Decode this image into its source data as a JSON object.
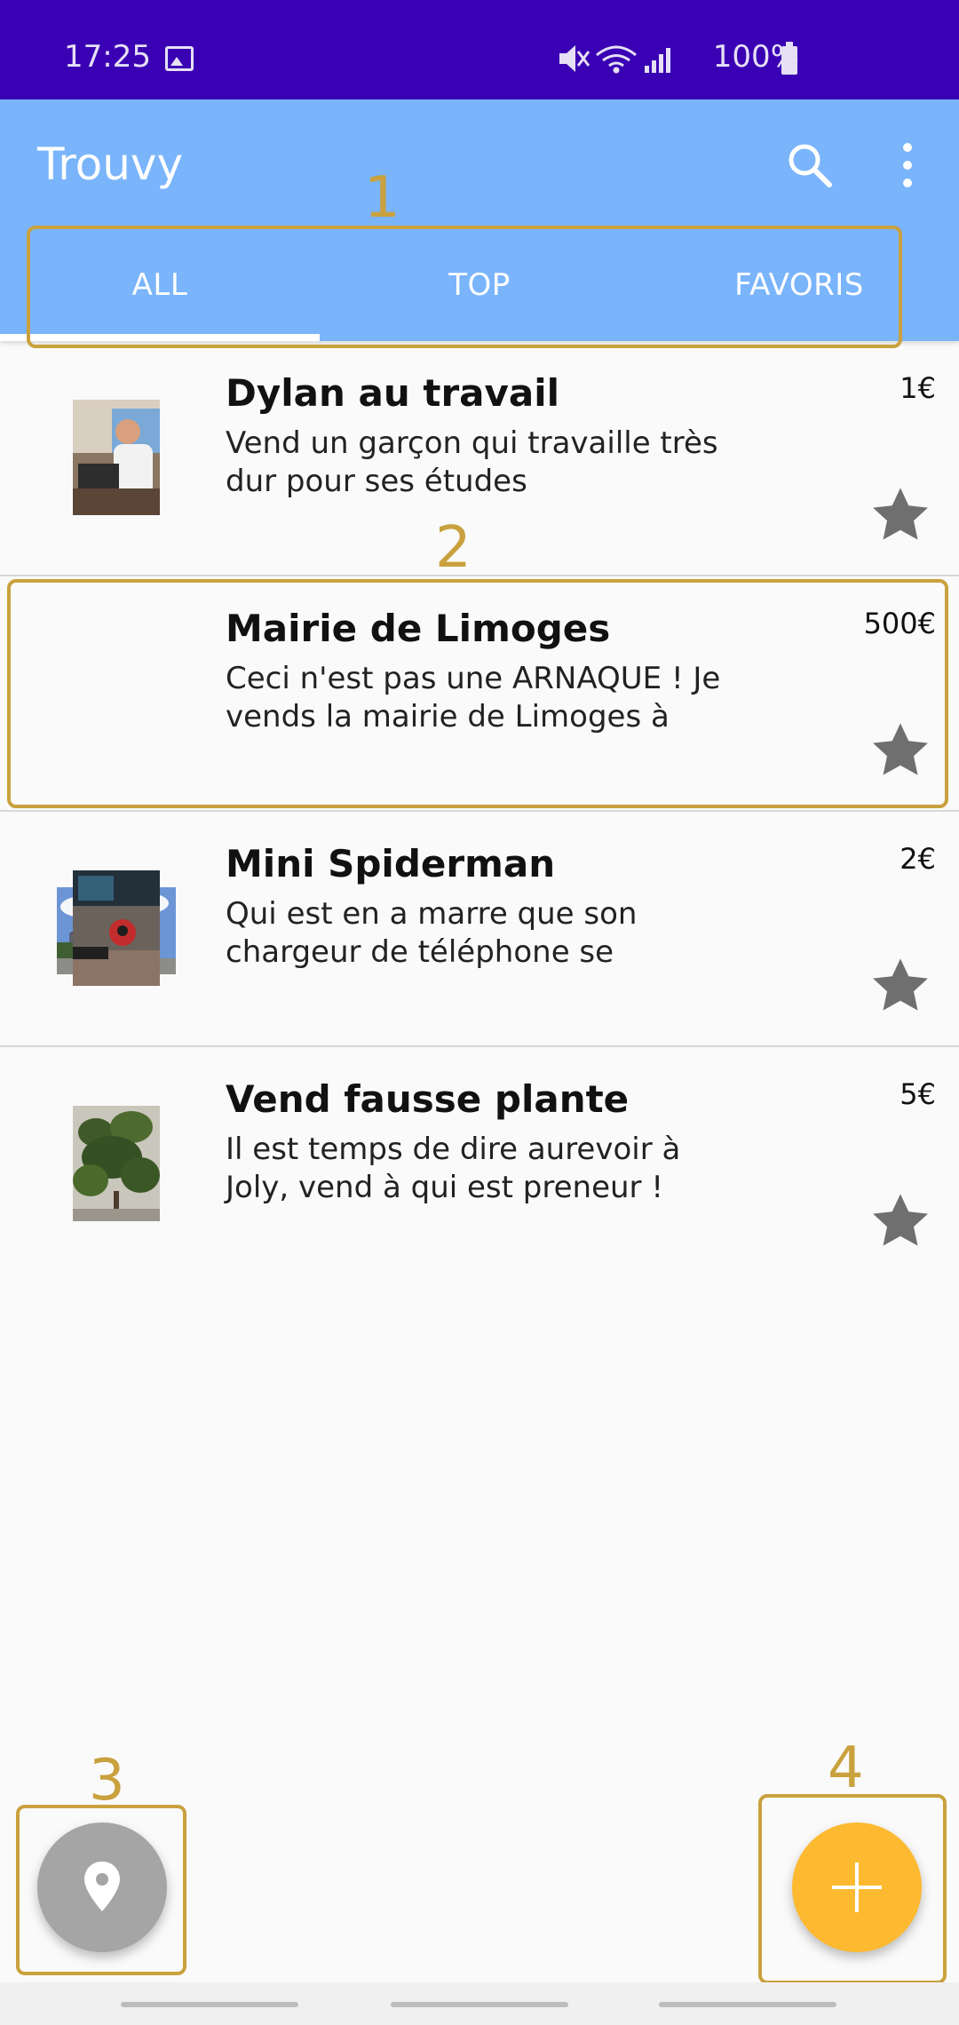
{
  "status": {
    "time": "17:25",
    "battery": "100%"
  },
  "appbar": {
    "title": "Trouvy"
  },
  "tabs": [
    {
      "label": "ALL",
      "selected": true
    },
    {
      "label": "TOP",
      "selected": false
    },
    {
      "label": "FAVORIS",
      "selected": false
    }
  ],
  "items": [
    {
      "title": "Dylan au travail",
      "desc": "Vend un garçon qui travaille très dur pour ses études",
      "price": "1€"
    },
    {
      "title": "Mairie de Limoges",
      "desc": "Ceci n'est pas une ARNAQUE ! Je vends la mairie de Limoges à",
      "price": "500€"
    },
    {
      "title": "Mini Spiderman",
      "desc": "Qui est en a marre que son chargeur de téléphone se",
      "price": "2€"
    },
    {
      "title": "Vend fausse plante",
      "desc": "Il est temps de dire aurevoir à Joly, vend à qui est preneur !",
      "price": "5€"
    }
  ],
  "annotations": [
    "1",
    "2",
    "3",
    "4"
  ],
  "colors": {
    "status_bar": "#3a00b3",
    "app_bar": "#7ab4fb",
    "annotation": "#c9a13e",
    "fab_add": "#fdb92f",
    "fab_location": "#a5a5a5",
    "star": "#6f6f6f"
  },
  "icons": {
    "search": "search-icon",
    "more": "more-vert-icon",
    "star": "star-icon",
    "location": "location-pin-icon",
    "add": "plus-icon"
  }
}
